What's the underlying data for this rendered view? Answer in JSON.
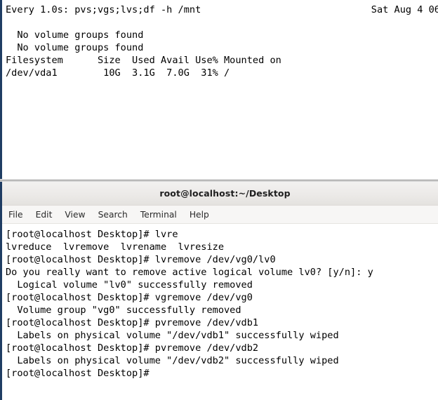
{
  "watch_pane": {
    "header_left": "Every 1.0s: pvs;vgs;lvs;df -h /mnt",
    "header_right": "Sat Aug  4 06",
    "lines": [
      "  No volume groups found",
      "  No volume groups found",
      "Filesystem      Size  Used Avail Use% Mounted on",
      "/dev/vda1        10G  3.1G  7.0G  31% /"
    ]
  },
  "terminal_window": {
    "title": "root@localhost:~/Desktop",
    "menu": [
      {
        "label": "File"
      },
      {
        "label": "Edit"
      },
      {
        "label": "View"
      },
      {
        "label": "Search"
      },
      {
        "label": "Terminal"
      },
      {
        "label": "Help"
      }
    ],
    "output_lines": [
      "[root@localhost Desktop]# lvre",
      "lvreduce  lvremove  lvrename  lvresize",
      "[root@localhost Desktop]# lvremove /dev/vg0/lv0",
      "Do you really want to remove active logical volume lv0? [y/n]: y",
      "  Logical volume \"lv0\" successfully removed",
      "[root@localhost Desktop]# vgremove /dev/vg0",
      "  Volume group \"vg0\" successfully removed",
      "[root@localhost Desktop]# pvremove /dev/vdb1",
      "  Labels on physical volume \"/dev/vdb1\" successfully wiped",
      "[root@localhost Desktop]# pvremove /dev/vdb2",
      "  Labels on physical volume \"/dev/vdb2\" successfully wiped",
      "[root@localhost Desktop]#"
    ]
  },
  "colors": {
    "window_border": "#1f3d63",
    "terminal_bg": "#ffffff",
    "terminal_fg": "#000000",
    "titlebar_bg": "#eceae8"
  }
}
